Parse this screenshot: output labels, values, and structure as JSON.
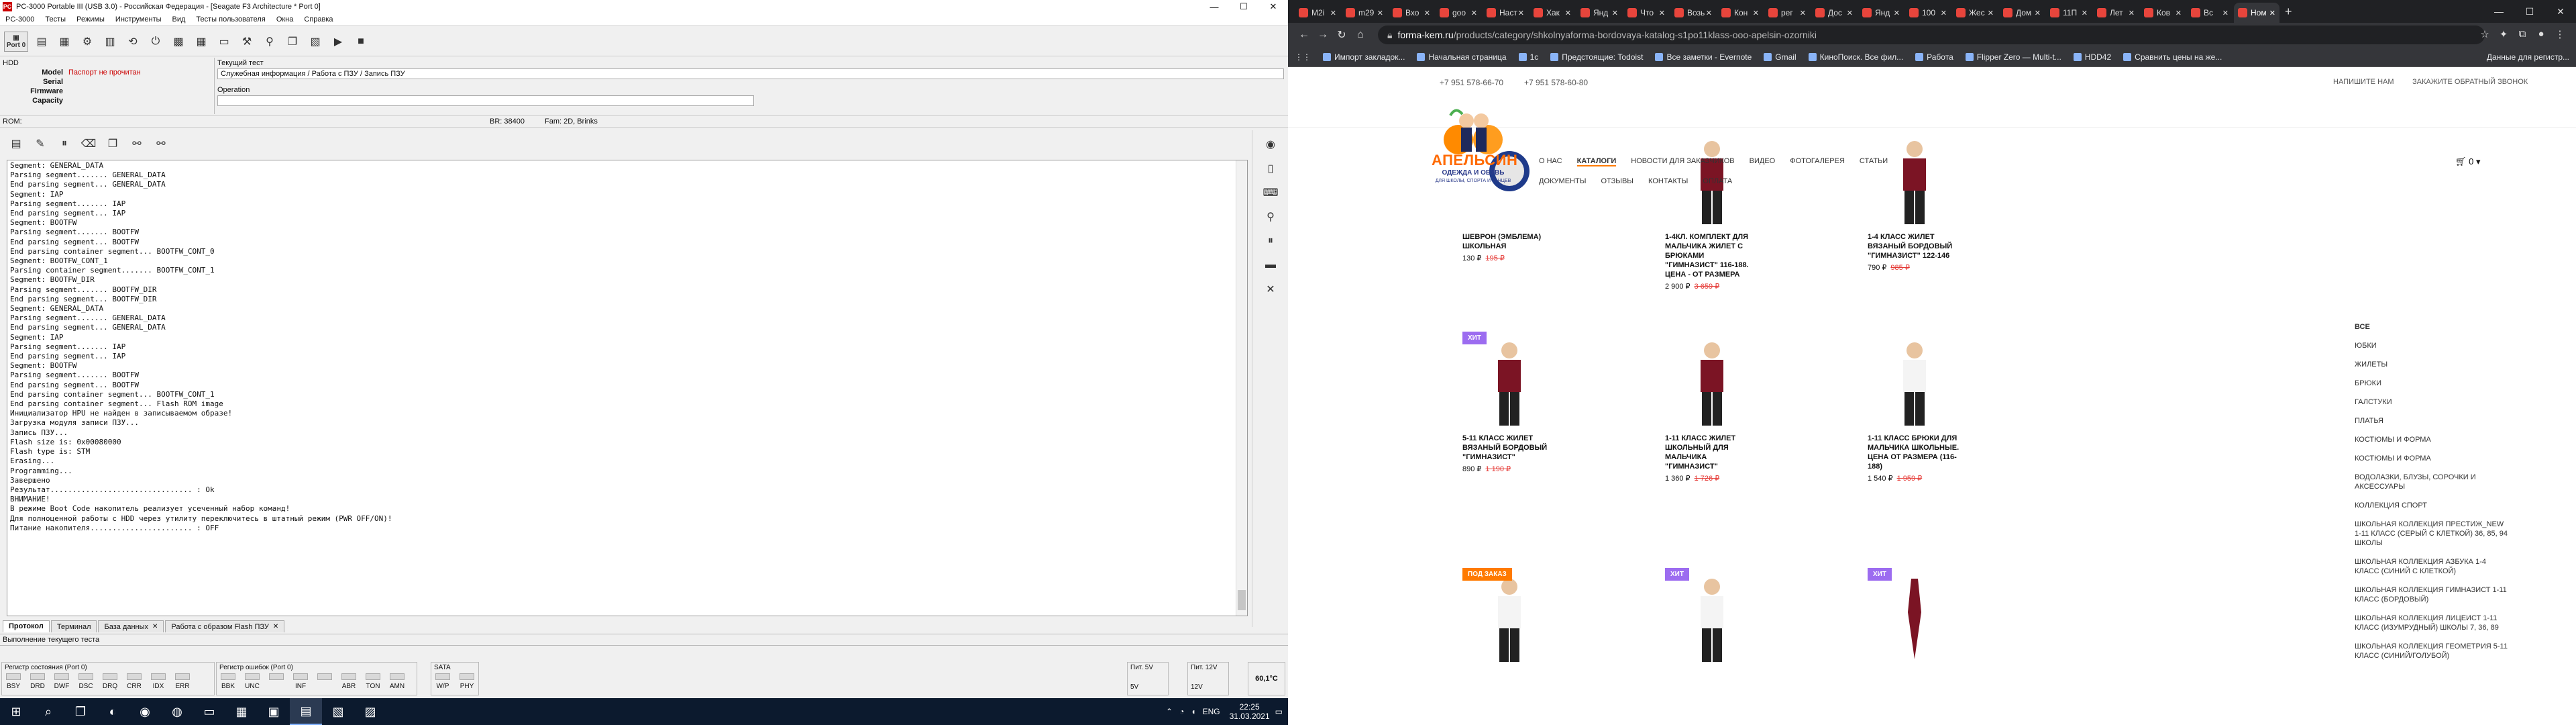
{
  "pc3000": {
    "title": "PC-3000 Portable III (USB 3.0) - Российская Федерация - [Seagate F3 Architecture * Port 0]",
    "logo_text": "PC",
    "window_controls": [
      "—",
      "☐",
      "✕"
    ],
    "menu": [
      "PC-3000",
      "Тесты",
      "Режимы",
      "Инструменты",
      "Вид",
      "Тесты пользователя",
      "Окна",
      "Справка"
    ],
    "port_label": "Port 0",
    "hdd": {
      "title": "HDD",
      "fields": [
        {
          "k": "Model",
          "v": "Паспорт не прочитан"
        },
        {
          "k": "Serial",
          "v": ""
        },
        {
          "k": "Firmware",
          "v": ""
        },
        {
          "k": "Capacity",
          "v": ""
        }
      ]
    },
    "current_test_label": "Текущий тест",
    "current_test_value": "Служебная информация / Работа с ПЗУ / Запись ПЗУ",
    "operation_label": "Operation",
    "status": {
      "rom": "ROM:",
      "br": "BR: 38400",
      "fam": "Fam: 2D, Brinks"
    },
    "log_lines": [
      "Segment: GENERAL_DATA",
      "Parsing segment....... GENERAL_DATA",
      "End parsing segment... GENERAL_DATA",
      "Segment: IAP",
      "Parsing segment....... IAP",
      "End parsing segment... IAP",
      "Segment: BOOTFW",
      "Parsing segment....... BOOTFW",
      "End parsing segment... BOOTFW",
      "End parsing container segment... BOOTFW_CONT_0",
      "Segment: BOOTFW_CONT_1",
      "Parsing container segment....... BOOTFW_CONT_1",
      "Segment: BOOTFW_DIR",
      "Parsing segment....... BOOTFW_DIR",
      "End parsing segment... BOOTFW_DIR",
      "Segment: GENERAL_DATA",
      "Parsing segment....... GENERAL_DATA",
      "End parsing segment... GENERAL_DATA",
      "Segment: IAP",
      "Parsing segment....... IAP",
      "End parsing segment... IAP",
      "Segment: BOOTFW",
      "Parsing segment....... BOOTFW",
      "End parsing segment... BOOTFW",
      "End parsing container segment... BOOTFW_CONT_1",
      "End parsing container segment... Flash ROM image",
      "Инициализатор HPU не найден в записываемом образе!",
      "Загрузка модуля записи ПЗУ...",
      "Запись ПЗУ...",
      "Flash size is: 0x00080000",
      "Flash type is: STM",
      "Erasing...",
      "Programming...",
      "Завершено",
      "Результат................................ : Ok",
      "ВНИМАНИЕ!",
      "В режиме Boot Code накопитель реализует усеченный набор команд!",
      "Для полноценной работы с HDD через утилиту переключитесь в штатный режим (PWR OFF/ON)!",
      "Питание накопителя....................... : OFF"
    ],
    "tabs": [
      {
        "label": "Протокол",
        "close": false
      },
      {
        "label": "Терминал",
        "close": false
      },
      {
        "label": "База данных",
        "close": true
      },
      {
        "label": "Работа с образом Flash ПЗУ",
        "close": true
      }
    ],
    "current_exec": "Выполнение текущего теста",
    "status_register": {
      "title": "Регистр состояния (Port 0)",
      "leds": [
        "BSY",
        "DRD",
        "DWF",
        "DSC",
        "DRQ",
        "CRR",
        "IDX",
        "ERR"
      ]
    },
    "error_register": {
      "title": "Регистр ошибок (Port 0)",
      "leds": [
        "BBK",
        "UNC",
        "",
        "INF",
        "",
        "ABR",
        "TON",
        "AMN"
      ]
    },
    "sata": {
      "title": "SATA",
      "leds": [
        "W/P",
        "PHY"
      ]
    },
    "power5": {
      "title": "Пит. 5V",
      "value": "5V"
    },
    "power12": {
      "title": "Пит. 12V",
      "value": "12V"
    },
    "temp": "60,1°C",
    "taskbar": {
      "lang": "ENG",
      "time": "22:25",
      "date": "31.03.2021"
    }
  },
  "browser": {
    "tabs": [
      "M2i",
      "m29",
      "Вхо",
      "goo",
      "Наст",
      "Хак",
      "Янд",
      "Что",
      "Возь",
      "Кон",
      "рег",
      "Дос",
      "Янд",
      "100",
      "Жес",
      "Дом",
      "11П",
      "Лет",
      "Ков",
      "Вс",
      "Ном"
    ],
    "active_tab_index": 20,
    "url_host": "forma-kem.ru",
    "url_path": "/products/category/shkolnyaforma-bordovaya-katalog-s1po11klass-ooo-apelsin-ozorniki",
    "bookmarks": [
      "Импорт закладок...",
      "Начальная страница",
      "1с",
      "Предстоящие: Todoist",
      "Все заметки - Evernote",
      "Gmail",
      "КиноПоиск. Все фил...",
      "Работа",
      "Flipper Zero — Multi-t...",
      "HDD42",
      "Сравнить цены на же..."
    ],
    "bookmarks_right": "Данные для регистр...",
    "site": {
      "phone1": "+7 951 578-66-70",
      "phone2": "+7 951 578-60-80",
      "write_us": "НАПИШИТЕ НАМ",
      "callback": "ЗАКАЖИТЕ ОБРАТНЫЙ ЗВОНОК",
      "logo_text": "АПЕЛЬСИН",
      "logo_sub": "ОДЕЖДА И ОБУВЬ",
      "logo_sub2": "ДЛЯ ШКОЛЫ, СПОРТА И ТАНЦЕВ",
      "nav": [
        "О НАС",
        "КАТАЛОГИ",
        "НОВОСТИ ДЛЯ ЗАКАЗЧИКОВ",
        "ВИДЕО",
        "ФОТОГАЛЕРЕЯ",
        "СТАТЬИ",
        "ДОКУМЕНТЫ",
        "ОТЗЫВЫ",
        "КОНТАКТЫ",
        "ОПЛАТА"
      ],
      "nav_active": "КАТАЛОГИ",
      "cart": "0",
      "products": [
        {
          "name": "ШЕВРОН (ЭМБЛЕМА) ШКОЛЬНАЯ",
          "price": "130 ₽",
          "old": "195 ₽",
          "badge": ""
        },
        {
          "name": "1-4КЛ. КОМПЛЕКТ ДЛЯ МАЛЬЧИКА ЖИЛЕТ С БРЮКАМИ \"ГИМНАЗИСТ\" 116-188. ЦЕНА - ОТ РАЗМЕРА",
          "price": "2 900 ₽",
          "old": "3 659 ₽",
          "badge": ""
        },
        {
          "name": "1-4 КЛАСС ЖИЛЕТ ВЯЗАНЫЙ БОРДОВЫЙ \"ГИМНАЗИСТ\" 122-146",
          "price": "790 ₽",
          "old": "985 ₽",
          "badge": ""
        },
        {
          "name": "5-11 КЛАСС ЖИЛЕТ ВЯЗАНЫЙ БОРДОВЫЙ \"ГИМНАЗИСТ\"",
          "price": "890 ₽",
          "old": "1 190 ₽",
          "badge": "ХИТ"
        },
        {
          "name": "1-11 КЛАСС ЖИЛЕТ ШКОЛЬНЫЙ ДЛЯ МАЛЬЧИКА \"ГИМНАЗИСТ\"",
          "price": "1 360 ₽",
          "old": "1 726 ₽",
          "badge": ""
        },
        {
          "name": "1-11 КЛАСС БРЮКИ ДЛЯ МАЛЬЧИКА ШКОЛЬНЫЕ. ЦЕНА ОТ РАЗМЕРА (116-188)",
          "price": "1 540 ₽",
          "old": "1 959 ₽",
          "badge": ""
        },
        {
          "name": "",
          "price": "",
          "old": "",
          "badge": "ПОД ЗАКАЗ"
        },
        {
          "name": "",
          "price": "",
          "old": "",
          "badge": "ХИТ"
        },
        {
          "name": "",
          "price": "",
          "old": "",
          "badge": "ХИТ"
        }
      ],
      "sidebar": [
        "ВСЕ",
        "ЮБКИ",
        "ЖИЛЕТЫ",
        "БРЮКИ",
        "ГАЛСТУКИ",
        "ПЛАТЬЯ",
        "КОСТЮМЫ И ФОРМА",
        "КОСТЮМЫ И ФОРМА",
        "ВОДОЛАЗКИ, БЛУЗЫ, СОРОЧКИ И АКСЕССУАРЫ",
        "КОЛЛЕКЦИЯ СПОРТ",
        "ШКОЛЬНАЯ КОЛЛЕКЦИЯ ПРЕСТИЖ_NEW 1-11 КЛАСС (СЕРЫЙ С КЛЕТКОЙ) 36, 85, 94 ШКОЛЫ",
        "ШКОЛЬНАЯ КОЛЛЕКЦИЯ АЗБУКА 1-4 КЛАСС (СИНИЙ С КЛЕТКОЙ)",
        "ШКОЛЬНАЯ КОЛЛЕКЦИЯ ГИМНАЗИСТ 1-11 КЛАСС (БОРДОВЫЙ)",
        "ШКОЛЬНАЯ КОЛЛЕКЦИЯ ЛИЦЕИСТ 1-11 КЛАСС (ИЗУМРУДНЫЙ) ШКОЛЫ 7, 36, 89",
        "ШКОЛЬНАЯ КОЛЛЕКЦИЯ ГЕОМЕТРИЯ 5-11 КЛАСС (СИНИЙ/ГОЛУБОЙ)"
      ],
      "colors": {
        "accent": "#ff7a00",
        "hit_badge": "#9c6cf0",
        "order_badge": "#ff7a00",
        "burgundy": "#7b1424",
        "old_price": "#e53935"
      }
    }
  }
}
